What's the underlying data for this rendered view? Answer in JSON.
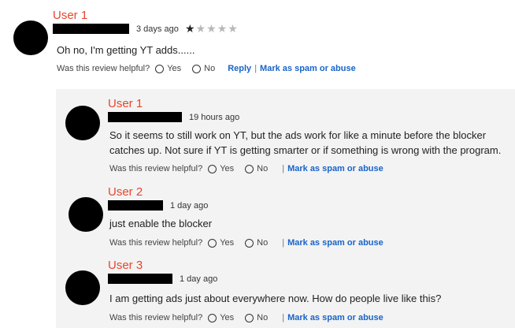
{
  "main_review": {
    "user": "User 1",
    "time": "3 days ago",
    "rating": 1,
    "max_rating": 5,
    "text": "Oh no, I'm getting YT adds......",
    "helpful_question": "Was this review helpful?",
    "yes_label": "Yes",
    "no_label": "No",
    "reply_label": "Reply",
    "spam_label": "Mark as spam or abuse"
  },
  "replies": [
    {
      "user": "User 1",
      "time": "19 hours ago",
      "text": "So it seems to still work on YT, but the ads work for like a minute before the blocker catches up.  Not sure if YT is getting smarter or if something is wrong with the program.",
      "helpful_question": "Was this review helpful?",
      "yes_label": "Yes",
      "no_label": "No",
      "spam_label": "Mark as spam or abuse"
    },
    {
      "user": "User 2",
      "time": "1 day ago",
      "text": "just enable the blocker",
      "helpful_question": "Was this review helpful?",
      "yes_label": "Yes",
      "no_label": "No",
      "spam_label": "Mark as spam or abuse"
    },
    {
      "user": "User 3",
      "time": "1 day ago",
      "text": "I am getting ads just about everywhere now.  How do people live like this?",
      "helpful_question": "Was this review helpful?",
      "yes_label": "Yes",
      "no_label": "No",
      "spam_label": "Mark as spam or abuse"
    }
  ],
  "colors": {
    "username": "#e8452c",
    "link": "#1a64c8",
    "reply_background": "#f3f3f3"
  }
}
